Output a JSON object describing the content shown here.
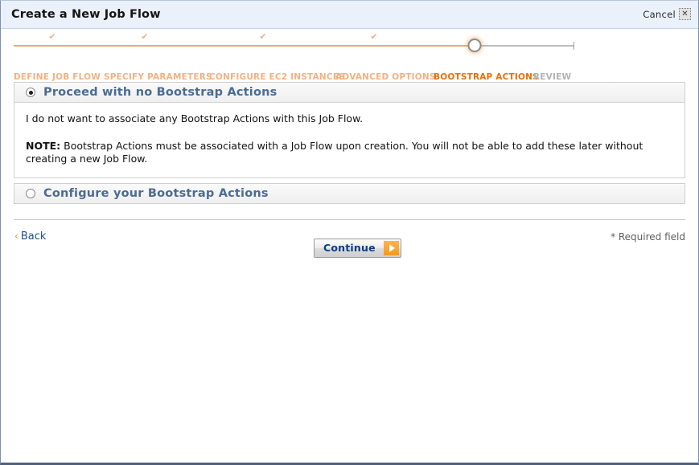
{
  "window": {
    "title": "Create a New Job Flow",
    "cancel_label": "Cancel",
    "close_glyph": "✕"
  },
  "stepper": {
    "check_glyph": "✔",
    "steps": [
      {
        "label": "DEFINE JOB FLOW",
        "state": "done"
      },
      {
        "label": "SPECIFY PARAMETERS",
        "state": "done"
      },
      {
        "label": "CONFIGURE EC2 INSTANCES",
        "state": "done"
      },
      {
        "label": "ADVANCED OPTIONS",
        "state": "done"
      },
      {
        "label": "BOOTSTRAP ACTIONS",
        "state": "active"
      },
      {
        "label": "REVIEW",
        "state": "todo"
      }
    ],
    "colors": {
      "done": "#f3b183",
      "active": "#e8700a",
      "todo": "#b4b4b4",
      "track_done": "#eda877",
      "track_todo": "#bdbdbd"
    }
  },
  "panels": [
    {
      "name": "proceed-with-no-bootstrap-actions",
      "title": "Proceed with no Bootstrap Actions",
      "selected": true,
      "body_line1": "I do not want to associate any Bootstrap Actions with this Job Flow.",
      "note_label": "NOTE:",
      "note_text": " Bootstrap Actions must be associated with a Job Flow upon creation. You will not be able to add these later without creating a new Job Flow."
    },
    {
      "name": "configure-your-bootstrap-actions",
      "title": "Configure your Bootstrap Actions",
      "selected": false
    }
  ],
  "footer": {
    "back_label": "Back",
    "back_chevron": "‹",
    "continue_label": "Continue",
    "required_note": "* Required field"
  }
}
